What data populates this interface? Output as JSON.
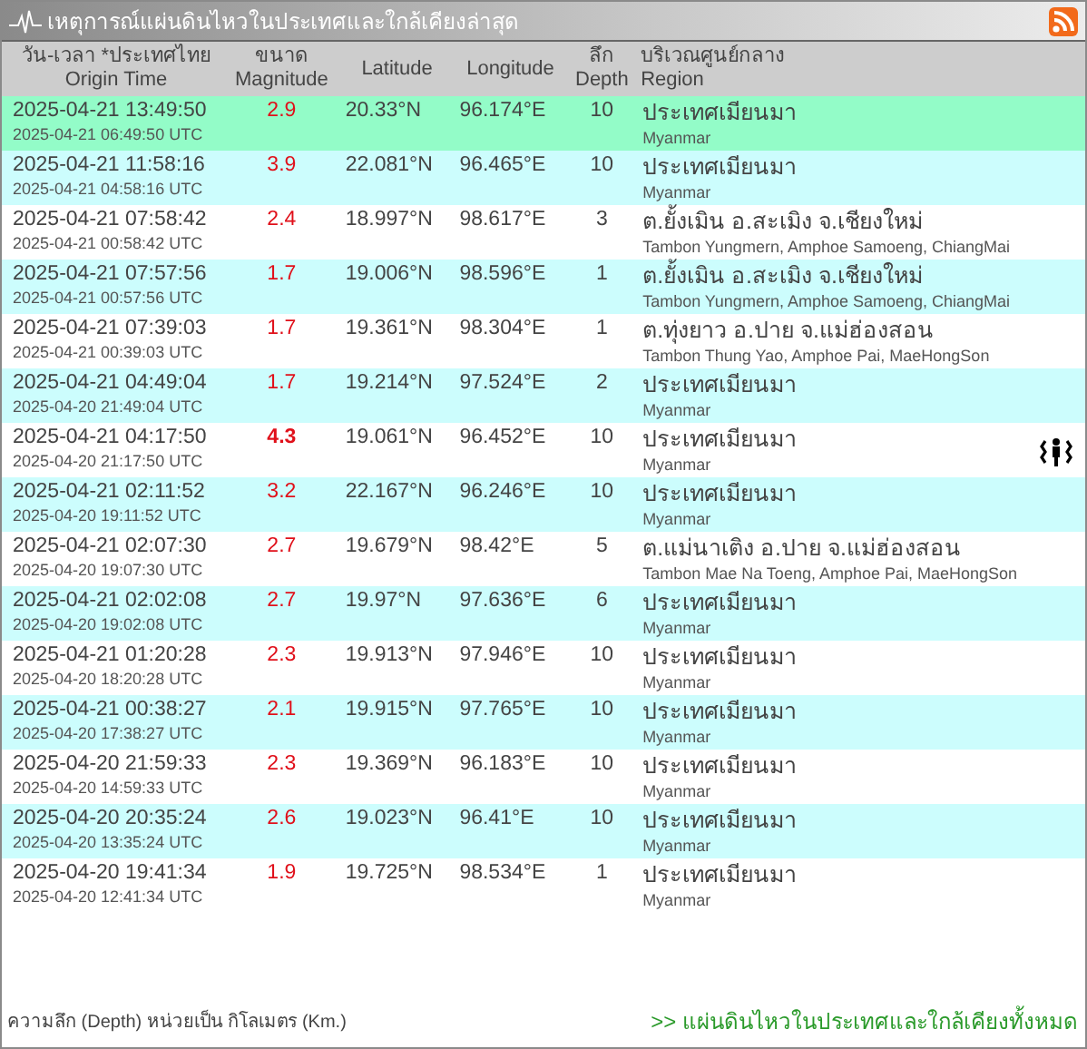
{
  "title": "เหตุการณ์แผ่นดินไหวในประเทศและใกล้เคียงล่าสุด",
  "columns": [
    {
      "th": "วัน-เวลา *ประเทศไทย",
      "en": "Origin Time"
    },
    {
      "th": "ขนาด",
      "en": "Magnitude"
    },
    {
      "en": "Latitude"
    },
    {
      "en": "Longitude"
    },
    {
      "th": "ลึก",
      "en": "Depth"
    },
    {
      "th": "บริเวณศูนย์กลาง",
      "en": "Region"
    }
  ],
  "rows": [
    {
      "time": "2025-04-21 13:49:50",
      "utc": "2025-04-21 06:49:50 UTC",
      "magnitude": "2.9",
      "latitude": "20.33°N",
      "longitude": "96.174°E",
      "depth": "10",
      "region_th": "ประเทศเมียนมา",
      "region_en": "Myanmar",
      "latest": true,
      "felt": false
    },
    {
      "time": "2025-04-21 11:58:16",
      "utc": "2025-04-21 04:58:16 UTC",
      "magnitude": "3.9",
      "latitude": "22.081°N",
      "longitude": "96.465°E",
      "depth": "10",
      "region_th": "ประเทศเมียนมา",
      "region_en": "Myanmar",
      "latest": false,
      "felt": false
    },
    {
      "time": "2025-04-21 07:58:42",
      "utc": "2025-04-21 00:58:42 UTC",
      "magnitude": "2.4",
      "latitude": "18.997°N",
      "longitude": "98.617°E",
      "depth": "3",
      "region_th": "ต.ยั้งเมิน อ.สะเมิง จ.เชียงใหม่",
      "region_en": "Tambon Yungmern, Amphoe Samoeng, ChiangMai",
      "latest": false,
      "felt": false
    },
    {
      "time": "2025-04-21 07:57:56",
      "utc": "2025-04-21 00:57:56 UTC",
      "magnitude": "1.7",
      "latitude": "19.006°N",
      "longitude": "98.596°E",
      "depth": "1",
      "region_th": "ต.ยั้งเมิน อ.สะเมิง จ.เชียงใหม่",
      "region_en": "Tambon Yungmern, Amphoe Samoeng, ChiangMai",
      "latest": false,
      "felt": false
    },
    {
      "time": "2025-04-21 07:39:03",
      "utc": "2025-04-21 00:39:03 UTC",
      "magnitude": "1.7",
      "latitude": "19.361°N",
      "longitude": "98.304°E",
      "depth": "1",
      "region_th": "ต.ทุ่งยาว อ.ปาย จ.แม่ฮ่องสอน",
      "region_en": "Tambon Thung Yao, Amphoe Pai, MaeHongSon",
      "latest": false,
      "felt": false
    },
    {
      "time": "2025-04-21 04:49:04",
      "utc": "2025-04-20 21:49:04 UTC",
      "magnitude": "1.7",
      "latitude": "19.214°N",
      "longitude": "97.524°E",
      "depth": "2",
      "region_th": "ประเทศเมียนมา",
      "region_en": "Myanmar",
      "latest": false,
      "felt": false
    },
    {
      "time": "2025-04-21 04:17:50",
      "utc": "2025-04-20 21:17:50 UTC",
      "magnitude": "4.3",
      "latitude": "19.061°N",
      "longitude": "96.452°E",
      "depth": "10",
      "region_th": "ประเทศเมียนมา",
      "region_en": "Myanmar",
      "latest": false,
      "felt": true
    },
    {
      "time": "2025-04-21 02:11:52",
      "utc": "2025-04-20 19:11:52 UTC",
      "magnitude": "3.2",
      "latitude": "22.167°N",
      "longitude": "96.246°E",
      "depth": "10",
      "region_th": "ประเทศเมียนมา",
      "region_en": "Myanmar",
      "latest": false,
      "felt": false
    },
    {
      "time": "2025-04-21 02:07:30",
      "utc": "2025-04-20 19:07:30 UTC",
      "magnitude": "2.7",
      "latitude": "19.679°N",
      "longitude": "98.42°E",
      "depth": "5",
      "region_th": "ต.แม่นาเติง อ.ปาย จ.แม่ฮ่องสอน",
      "region_en": "Tambon Mae Na Toeng, Amphoe Pai, MaeHongSon",
      "latest": false,
      "felt": false
    },
    {
      "time": "2025-04-21 02:02:08",
      "utc": "2025-04-20 19:02:08 UTC",
      "magnitude": "2.7",
      "latitude": "19.97°N",
      "longitude": "97.636°E",
      "depth": "6",
      "region_th": "ประเทศเมียนมา",
      "region_en": "Myanmar",
      "latest": false,
      "felt": false
    },
    {
      "time": "2025-04-21 01:20:28",
      "utc": "2025-04-20 18:20:28 UTC",
      "magnitude": "2.3",
      "latitude": "19.913°N",
      "longitude": "97.946°E",
      "depth": "10",
      "region_th": "ประเทศเมียนมา",
      "region_en": "Myanmar",
      "latest": false,
      "felt": false
    },
    {
      "time": "2025-04-21 00:38:27",
      "utc": "2025-04-20 17:38:27 UTC",
      "magnitude": "2.1",
      "latitude": "19.915°N",
      "longitude": "97.765°E",
      "depth": "10",
      "region_th": "ประเทศเมียนมา",
      "region_en": "Myanmar",
      "latest": false,
      "felt": false
    },
    {
      "time": "2025-04-20 21:59:33",
      "utc": "2025-04-20 14:59:33 UTC",
      "magnitude": "2.3",
      "latitude": "19.369°N",
      "longitude": "96.183°E",
      "depth": "10",
      "region_th": "ประเทศเมียนมา",
      "region_en": "Myanmar",
      "latest": false,
      "felt": false
    },
    {
      "time": "2025-04-20 20:35:24",
      "utc": "2025-04-20 13:35:24 UTC",
      "magnitude": "2.6",
      "latitude": "19.023°N",
      "longitude": "96.41°E",
      "depth": "10",
      "region_th": "ประเทศเมียนมา",
      "region_en": "Myanmar",
      "latest": false,
      "felt": false
    },
    {
      "time": "2025-04-20 19:41:34",
      "utc": "2025-04-20 12:41:34 UTC",
      "magnitude": "1.9",
      "latitude": "19.725°N",
      "longitude": "98.534°E",
      "depth": "1",
      "region_th": "ประเทศเมียนมา",
      "region_en": "Myanmar",
      "latest": false,
      "felt": false
    }
  ],
  "footer_note": "ความลึก (Depth) หน่วยเป็น กิโลเมตร (Km.)",
  "footer_link": ">> แผ่นดินไหวในประเทศและใกล้เคียงทั้งหมด"
}
